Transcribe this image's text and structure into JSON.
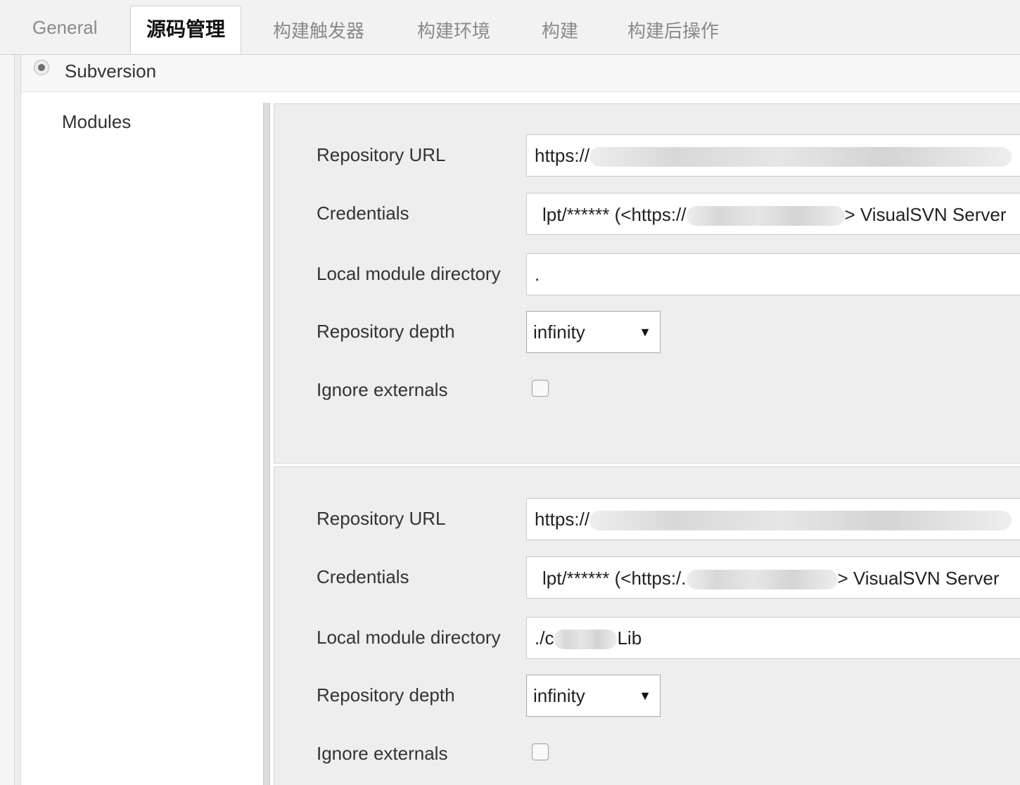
{
  "tabs": [
    {
      "label": "General"
    },
    {
      "label": "源码管理"
    },
    {
      "label": "构建触发器"
    },
    {
      "label": "构建环境"
    },
    {
      "label": "构建"
    },
    {
      "label": "构建后操作"
    }
  ],
  "scm": {
    "label": "Subversion"
  },
  "modules_label": "Modules",
  "field_labels": {
    "repo_url": "Repository URL",
    "credentials": "Credentials",
    "local_dir": "Local module directory",
    "depth": "Repository depth",
    "ignore_externals": "Ignore externals"
  },
  "modules": [
    {
      "url_prefix": "https://",
      "cred_prefix": "lpt/****** (<https://",
      "cred_suffix": "> VisualSVN Server",
      "local_dir": ".",
      "depth": "infinity",
      "ignore_externals": false
    },
    {
      "url_prefix": "https://",
      "cred_prefix": "lpt/****** (<https:/.",
      "cred_suffix": "> VisualSVN Server",
      "local_dir_prefix": "./c",
      "local_dir_suffix": "Lib",
      "depth": "infinity",
      "ignore_externals": false
    }
  ]
}
